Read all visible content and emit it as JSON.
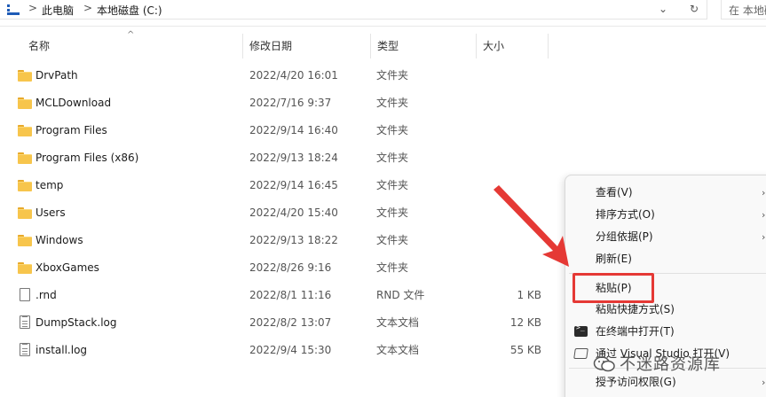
{
  "address_bar": {
    "breadcrumbs": [
      "此电脑",
      "本地磁盘 (C:)"
    ],
    "separator": ">",
    "dropdown_glyph": "⌄",
    "refresh_glyph": "↻",
    "search_placeholder": "在 本地磁盘 (C:) 中搜索"
  },
  "columns": {
    "name": "名称",
    "modified": "修改日期",
    "type": "类型",
    "size": "大小",
    "sort_glyph": "^"
  },
  "files": [
    {
      "name": "DrvPath",
      "date": "2022/4/20 16:01",
      "type": "文件夹",
      "size": "",
      "icon": "folder-icon"
    },
    {
      "name": "MCLDownload",
      "date": "2022/7/16 9:37",
      "type": "文件夹",
      "size": "",
      "icon": "folder-icon"
    },
    {
      "name": "Program Files",
      "date": "2022/9/14 16:40",
      "type": "文件夹",
      "size": "",
      "icon": "folder-icon"
    },
    {
      "name": "Program Files (x86)",
      "date": "2022/9/13 18:24",
      "type": "文件夹",
      "size": "",
      "icon": "folder-icon"
    },
    {
      "name": "temp",
      "date": "2022/9/14 16:45",
      "type": "文件夹",
      "size": "",
      "icon": "folder-icon"
    },
    {
      "name": "Users",
      "date": "2022/4/20 15:40",
      "type": "文件夹",
      "size": "",
      "icon": "folder-icon"
    },
    {
      "name": "Windows",
      "date": "2022/9/13 18:22",
      "type": "文件夹",
      "size": "",
      "icon": "folder-icon"
    },
    {
      "name": "XboxGames",
      "date": "2022/8/26 9:16",
      "type": "文件夹",
      "size": "",
      "icon": "folder-icon"
    },
    {
      "name": ".rnd",
      "date": "2022/8/1 11:16",
      "type": "RND 文件",
      "size": "1 KB",
      "icon": "file-icon"
    },
    {
      "name": "DumpStack.log",
      "date": "2022/8/2 13:07",
      "type": "文本文档",
      "size": "12 KB",
      "icon": "text-file-icon"
    },
    {
      "name": "install.log",
      "date": "2022/9/4 15:30",
      "type": "文本文档",
      "size": "55 KB",
      "icon": "text-file-icon"
    }
  ],
  "context_menu": {
    "items": [
      {
        "label": "查看(V)",
        "chevron": "›"
      },
      {
        "label": "排序方式(O)",
        "chevron": "›"
      },
      {
        "label": "分组依据(P)",
        "chevron": "›"
      },
      {
        "label": "刷新(E)",
        "chevron": ""
      },
      {
        "label": "粘贴(P)",
        "chevron": ""
      },
      {
        "label": "粘贴快捷方式(S)",
        "chevron": ""
      },
      {
        "label": "在终端中打开(T)",
        "chevron": "",
        "icon": "terminal-icon"
      },
      {
        "label": "通过 Visual Studio 打开(V)",
        "chevron": "",
        "icon": "visual-studio-icon"
      },
      {
        "label": "授予访问权限(G)",
        "chevron": "›"
      }
    ]
  },
  "watermark": {
    "text": "不迷路资源库"
  },
  "colors": {
    "annotation_red": "#e53935",
    "folder_yellow": "#f7c54c"
  }
}
